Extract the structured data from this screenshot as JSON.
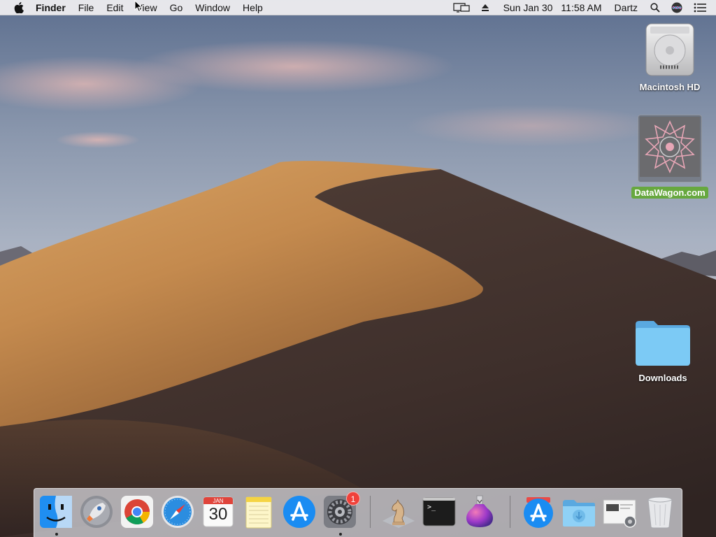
{
  "menubar": {
    "app_name": "Finder",
    "menus": [
      "File",
      "Edit",
      "View",
      "Go",
      "Window",
      "Help"
    ],
    "clock_date": "Sun Jan 30",
    "clock_time": "11:58 AM",
    "user_name": "Dartz"
  },
  "desktop": {
    "icons": [
      {
        "label": "Macintosh HD"
      },
      {
        "label": "DataWagon.com"
      },
      {
        "label": "Downloads"
      }
    ]
  },
  "dock": {
    "calendar_month": "JAN",
    "calendar_day": "30",
    "system_preferences_badge": "1",
    "terminal_prompt": ">_"
  },
  "colors": {
    "selection_label": "#67a83f",
    "badge": "#f0413a",
    "folder": "#6ec1f2"
  }
}
